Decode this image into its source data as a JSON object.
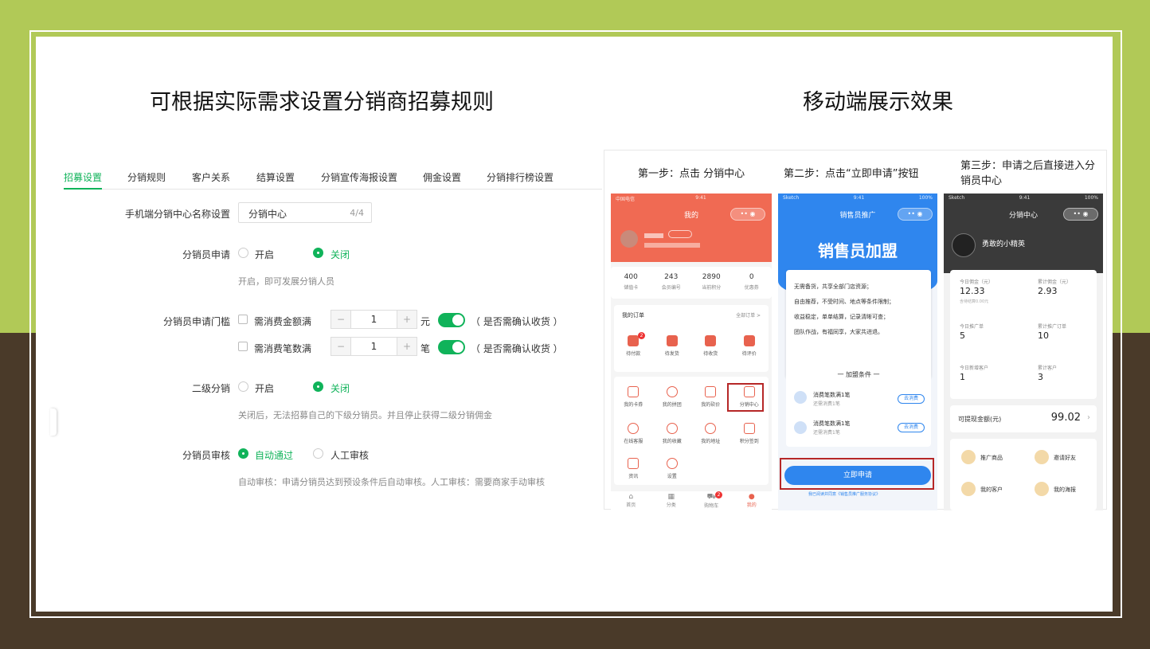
{
  "titles": {
    "left": "可根据实际需求设置分销商招募规则",
    "right": "移动端展示效果"
  },
  "colors": {
    "accent_green": "#10b35a",
    "bg_top": "#b1c957",
    "bg_bottom": "#4a3a29",
    "phone1_header": "#f06a53",
    "phone2_header": "#2f86ee",
    "phone3_header": "#3a3a3a"
  },
  "tabs": [
    "招募设置",
    "分销规则",
    "客户关系",
    "结算设置",
    "分销宣传海报设置",
    "佣金设置",
    "分销排行榜设置"
  ],
  "form": {
    "name_label": "手机端分销中心名称设置",
    "name_value": "分销中心",
    "name_count": "4/4",
    "apply_label": "分销员申请",
    "apply_on": "开启",
    "apply_off": "关闭",
    "apply_help": "开启，即可发展分销人员",
    "threshold_label": "分销员申请门槛",
    "threshold_amount": "需消费金额满",
    "threshold_amount_value": "1",
    "threshold_amount_unit": "元",
    "threshold_count": "需消费笔数满",
    "threshold_count_value": "1",
    "threshold_count_unit": "笔",
    "confirm_note": "（ 是否需确认收货 ）",
    "level2_label": "二级分销",
    "level2_on": "开启",
    "level2_off": "关闭",
    "level2_help": "关闭后，无法招募自己的下级分销员。并且停止获得二级分销佣金",
    "audit_label": "分销员审核",
    "audit_auto": "自动通过",
    "audit_manual": "人工审核",
    "audit_help": "自动审核：申请分销员达到预设条件后自动审核。人工审核：需要商家手动审核"
  },
  "steps": {
    "s1": "第一步：点击 分销中心",
    "s2": "第二步：点击“立即申请”按钮",
    "s3": "第三步：申请之后直接进入分销员中心"
  },
  "phone1": {
    "status_left": "中国电信",
    "status_time": "9:41",
    "title": "我的",
    "stats": [
      {
        "v": "400",
        "l": "储值卡"
      },
      {
        "v": "243",
        "l": "会员编号"
      },
      {
        "v": "2890",
        "l": "当前积分"
      },
      {
        "v": "0",
        "l": "优惠券"
      }
    ],
    "orders_title": "我的订单",
    "orders_all": "全部订单 >",
    "order_items": [
      "待付款",
      "待发货",
      "待收货",
      "待评价"
    ],
    "order_badge": "2",
    "grid_row1": [
      "我的卡券",
      "我的拼团",
      "我的砍价",
      "分销中心"
    ],
    "grid_row2": [
      "在线客服",
      "我的收藏",
      "我的地址",
      "积分签到"
    ],
    "grid_row3": [
      "资讯",
      "设置"
    ],
    "nav": [
      "首页",
      "分类",
      "购物车",
      "我的"
    ],
    "cart_badge": "2"
  },
  "phone2": {
    "status_left": "Sketch",
    "status_time": "9:41",
    "status_right": "100%",
    "title": "销售员推广",
    "hero": "销售员加盟",
    "benefits": [
      "无需备货，共享全部门店资源；",
      "自由推荐，不受时间、地点等条件限制；",
      "收益稳定，单单结算，记录清晰可查；",
      "团队作战，有福同享，大家共进退。"
    ],
    "conditions_title": "一 加盟条件 一",
    "conditions": [
      {
        "t": "消费笔数满1笔",
        "s": "还需消费1笔",
        "btn": "去消费"
      },
      {
        "t": "消费笔数满1笔",
        "s": "还需消费1笔",
        "btn": "去消费"
      }
    ],
    "apply_button": "立即申请",
    "agree_text": "我已阅读并同意《销售员推广服务协议》"
  },
  "phone3": {
    "status_left": "Sketch",
    "status_time": "9:41",
    "status_right": "100%",
    "title": "分销中心",
    "username": "勇敢的小精英",
    "stats": [
      {
        "l": "今日佣金（元）",
        "v": "12.33",
        "s": "含待结算0.00元"
      },
      {
        "l": "累计佣金（元）",
        "v": "2.93",
        "s": ""
      },
      {
        "l": "今日推广单",
        "v": "5",
        "s": ""
      },
      {
        "l": "累计推广订单",
        "v": "10",
        "s": ""
      },
      {
        "l": "今日新增客户",
        "v": "1",
        "s": ""
      },
      {
        "l": "累计客户",
        "v": "3",
        "s": ""
      }
    ],
    "withdraw_label": "可提现金额(元)",
    "withdraw_value": "99.02",
    "menu": [
      "推广商品",
      "邀请好友",
      "我的客户",
      "我的海报"
    ]
  }
}
